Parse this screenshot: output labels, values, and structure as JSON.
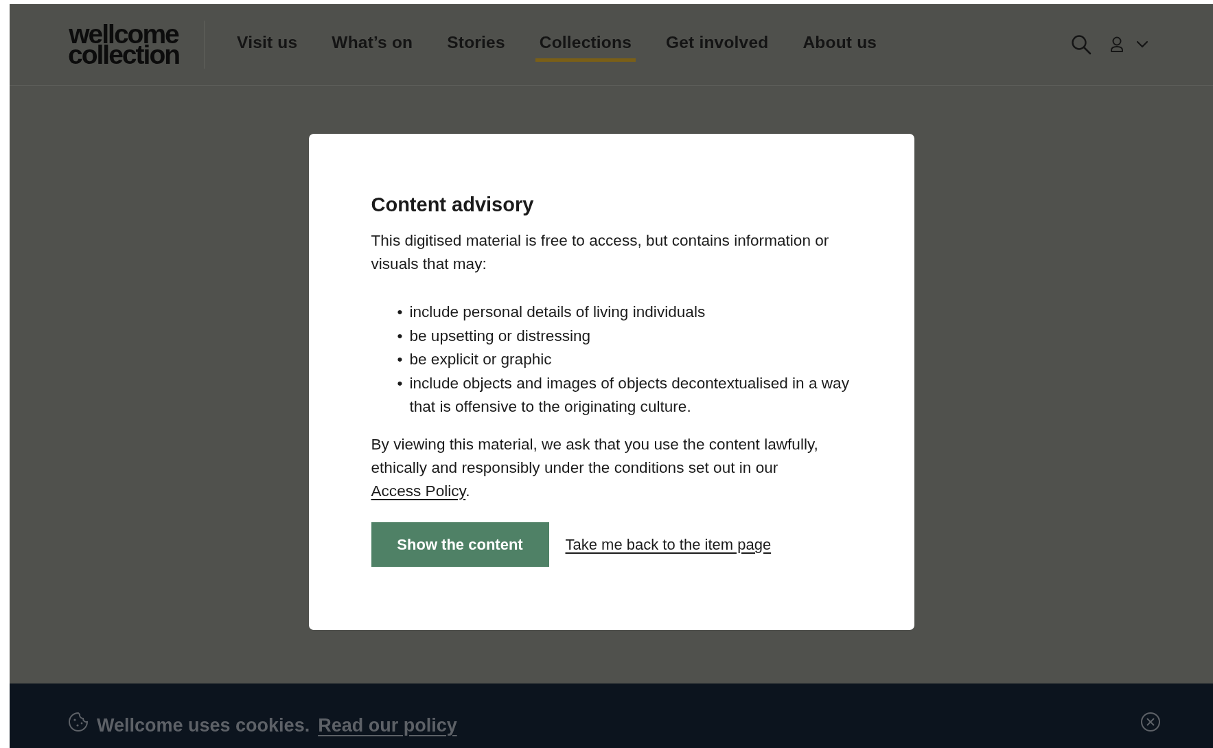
{
  "header": {
    "logo": [
      "wellcome",
      "collection"
    ],
    "nav": [
      {
        "label": "Visit us",
        "selected": false
      },
      {
        "label": "What’s on",
        "selected": false
      },
      {
        "label": "Stories",
        "selected": false
      },
      {
        "label": "Collections",
        "selected": true
      },
      {
        "label": "Get involved",
        "selected": false
      },
      {
        "label": "About us",
        "selected": false
      }
    ]
  },
  "modal": {
    "title": "Content advisory",
    "intro": "This digitised material is free to access, but contains information or visuals that may:",
    "bullets": [
      {
        "marker": "•",
        "text": "include personal details of living individuals"
      },
      {
        "marker": "•",
        "text": "be upsetting or distressing"
      },
      {
        "marker": "•",
        "text": "be explicit or graphic"
      },
      {
        "marker": "•",
        "text": "include objects and images of objects decontextualised in a way that is offensive to the originating culture."
      }
    ],
    "outro_before": "By viewing this material, we ask that you use the content lawfully, ethically and responsibly under the conditions set out in our",
    "outro_link": "Access Policy",
    "outro_after": ".",
    "primary_button": "Show the content",
    "secondary_link": "Take me back to the item page"
  },
  "cookie_banner": {
    "text": "Wellcome uses cookies.",
    "link": "Read our policy"
  }
}
